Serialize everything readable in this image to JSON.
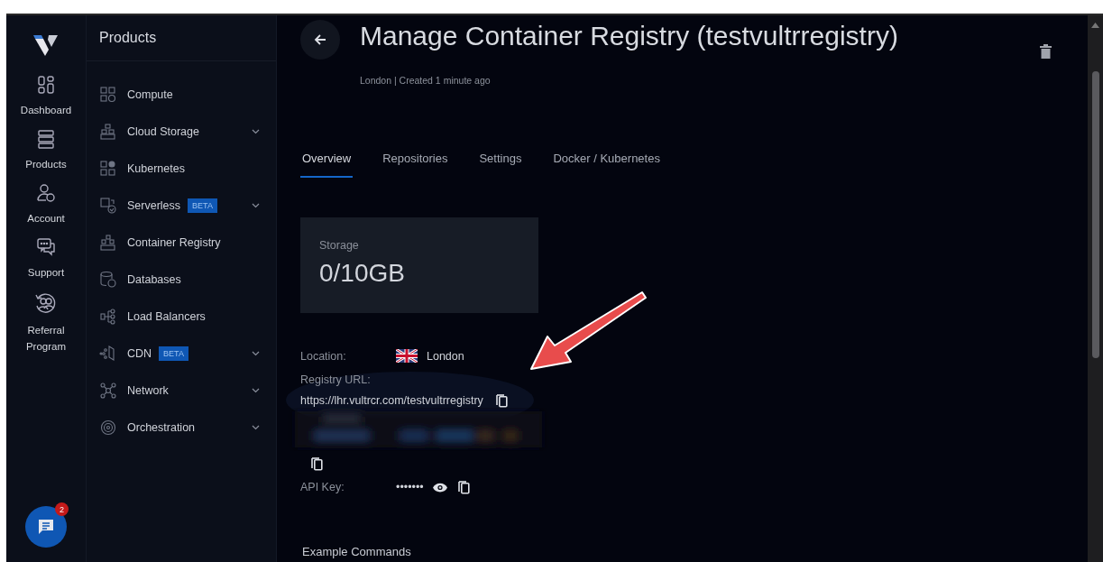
{
  "rail": {
    "items": [
      {
        "label": "Dashboard"
      },
      {
        "label": "Products"
      },
      {
        "label": "Account"
      },
      {
        "label": "Support"
      },
      {
        "label": "Referral Program"
      }
    ],
    "chat": {
      "badge": "2"
    }
  },
  "products_menu": {
    "title": "Products",
    "items": [
      {
        "label": "Compute",
        "expandable": false
      },
      {
        "label": "Cloud Storage",
        "expandable": true
      },
      {
        "label": "Kubernetes",
        "expandable": false
      },
      {
        "label": "Serverless",
        "badge": "BETA",
        "expandable": true
      },
      {
        "label": "Container Registry",
        "expandable": false
      },
      {
        "label": "Databases",
        "expandable": false
      },
      {
        "label": "Load Balancers",
        "expandable": false
      },
      {
        "label": "CDN",
        "badge": "BETA",
        "expandable": true
      },
      {
        "label": "Network",
        "expandable": true
      },
      {
        "label": "Orchestration",
        "expandable": true
      }
    ]
  },
  "page": {
    "title": "Manage Container Registry (testvultrregistry)",
    "subtitle": "London | Created 1 minute ago",
    "tabs": [
      {
        "label": "Overview",
        "selected": true
      },
      {
        "label": "Repositories",
        "selected": false
      },
      {
        "label": "Settings",
        "selected": false
      },
      {
        "label": "Docker / Kubernetes",
        "selected": false
      }
    ],
    "storage": {
      "label": "Storage",
      "value": "0/10GB"
    },
    "location": {
      "label": "Location:",
      "value": "London"
    },
    "registry_url": {
      "label": "Registry URL:",
      "value": "https://lhr.vultrcr.com/testvultrregistry"
    },
    "api_key": {
      "label": "API Key:",
      "value": "•••••••"
    },
    "example_commands": {
      "title": "Example Commands"
    }
  }
}
